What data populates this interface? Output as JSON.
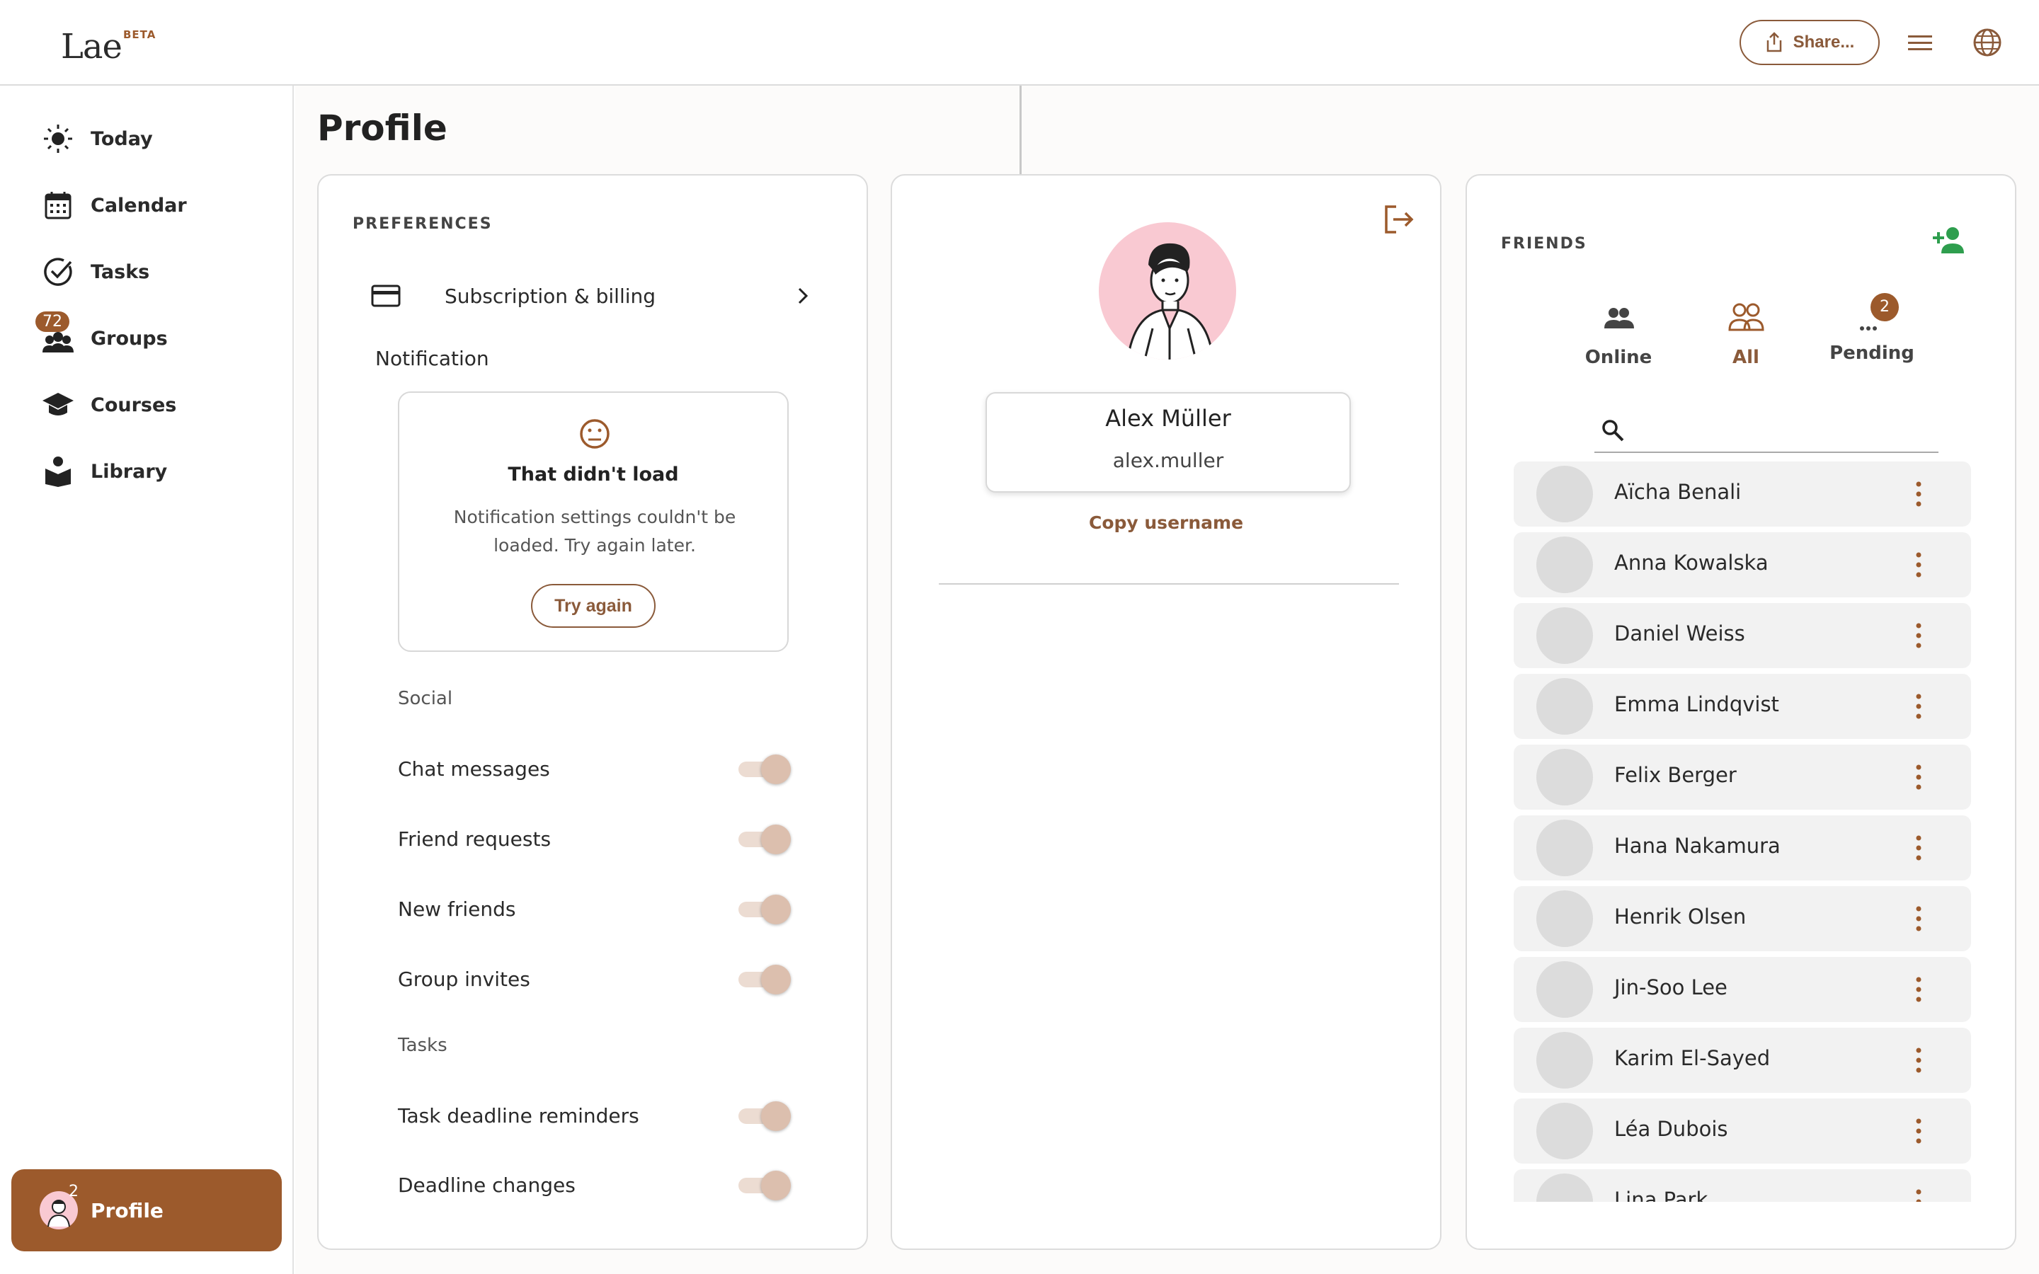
{
  "app": {
    "logo_text": "Lae",
    "logo_badge": "BETA"
  },
  "topbar": {
    "share_label": "Share..."
  },
  "sidebar": {
    "items": [
      {
        "label": "Today",
        "icon": "sun-icon"
      },
      {
        "label": "Calendar",
        "icon": "calendar-icon"
      },
      {
        "label": "Tasks",
        "icon": "check-circle-icon"
      },
      {
        "label": "Groups",
        "icon": "groups-icon",
        "badge": "72"
      },
      {
        "label": "Courses",
        "icon": "graduation-cap-icon"
      },
      {
        "label": "Library",
        "icon": "book-reader-icon"
      }
    ],
    "profile": {
      "label": "Profile",
      "badge": "2"
    }
  },
  "page": {
    "title": "Profile"
  },
  "preferences": {
    "heading": "PREFERENCES",
    "subscription_label": "Subscription & billing",
    "notification_heading": "Notification",
    "error": {
      "title": "That didn't load",
      "message": "Notification settings couldn't be loaded. Try again later.",
      "retry_label": "Try again"
    },
    "social_label": "Social",
    "social_toggles": [
      {
        "label": "Chat messages",
        "on": true
      },
      {
        "label": "Friend requests",
        "on": true
      },
      {
        "label": "New friends",
        "on": true
      },
      {
        "label": "Group invites",
        "on": true
      }
    ],
    "tasks_label": "Tasks",
    "task_toggles": [
      {
        "label": "Task deadline reminders",
        "on": true
      },
      {
        "label": "Deadline changes",
        "on": true
      }
    ]
  },
  "profile_card": {
    "name": "Alex Müller",
    "username": "alex.muller",
    "copy_label": "Copy username"
  },
  "friends": {
    "heading": "FRIENDS",
    "tabs": [
      {
        "label": "Online"
      },
      {
        "label": "All"
      },
      {
        "label": "Pending",
        "badge": "2"
      }
    ],
    "active_tab": "All",
    "search_value": "",
    "list": [
      "Aïcha Benali",
      "Anna Kowalska",
      "Daniel Weiss",
      "Emma Lindqvist",
      "Felix Berger",
      "Hana Nakamura",
      "Henrik Olsen",
      "Jin-Soo Lee",
      "Karim El-Sayed",
      "Léa Dubois",
      "Lina Park"
    ]
  },
  "colors": {
    "accent": "#9c5a2c",
    "accent_text": "#8a5a3a",
    "add_friend": "#2e9e4e",
    "avatar_bg": "#f9c9d2"
  }
}
